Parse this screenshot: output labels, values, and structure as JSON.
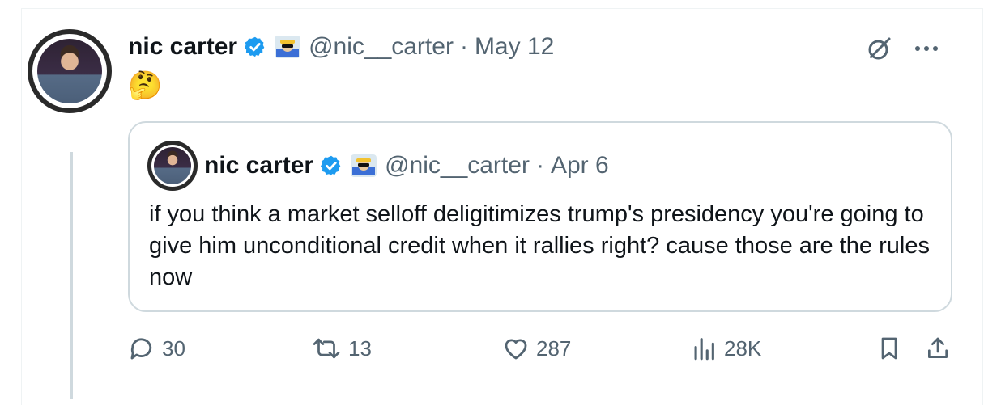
{
  "tweet": {
    "author_name": "nic carter",
    "handle": "@nic__carter",
    "separator": "·",
    "date": "May 12",
    "text": "🤔"
  },
  "quoted": {
    "author_name": "nic carter",
    "handle": "@nic__carter",
    "separator": "·",
    "date": "Apr 6",
    "text": "if you think a market selloff deligitimizes trump's presidency you're going to give him unconditional credit when it rallies right? cause those are the rules now"
  },
  "actions": {
    "replies": "30",
    "reposts": "13",
    "likes": "287",
    "views": "28K"
  },
  "colors": {
    "text": "#0f1419",
    "secondary": "#536471",
    "verified": "#1d9bf0",
    "border": "#cfd9de"
  }
}
